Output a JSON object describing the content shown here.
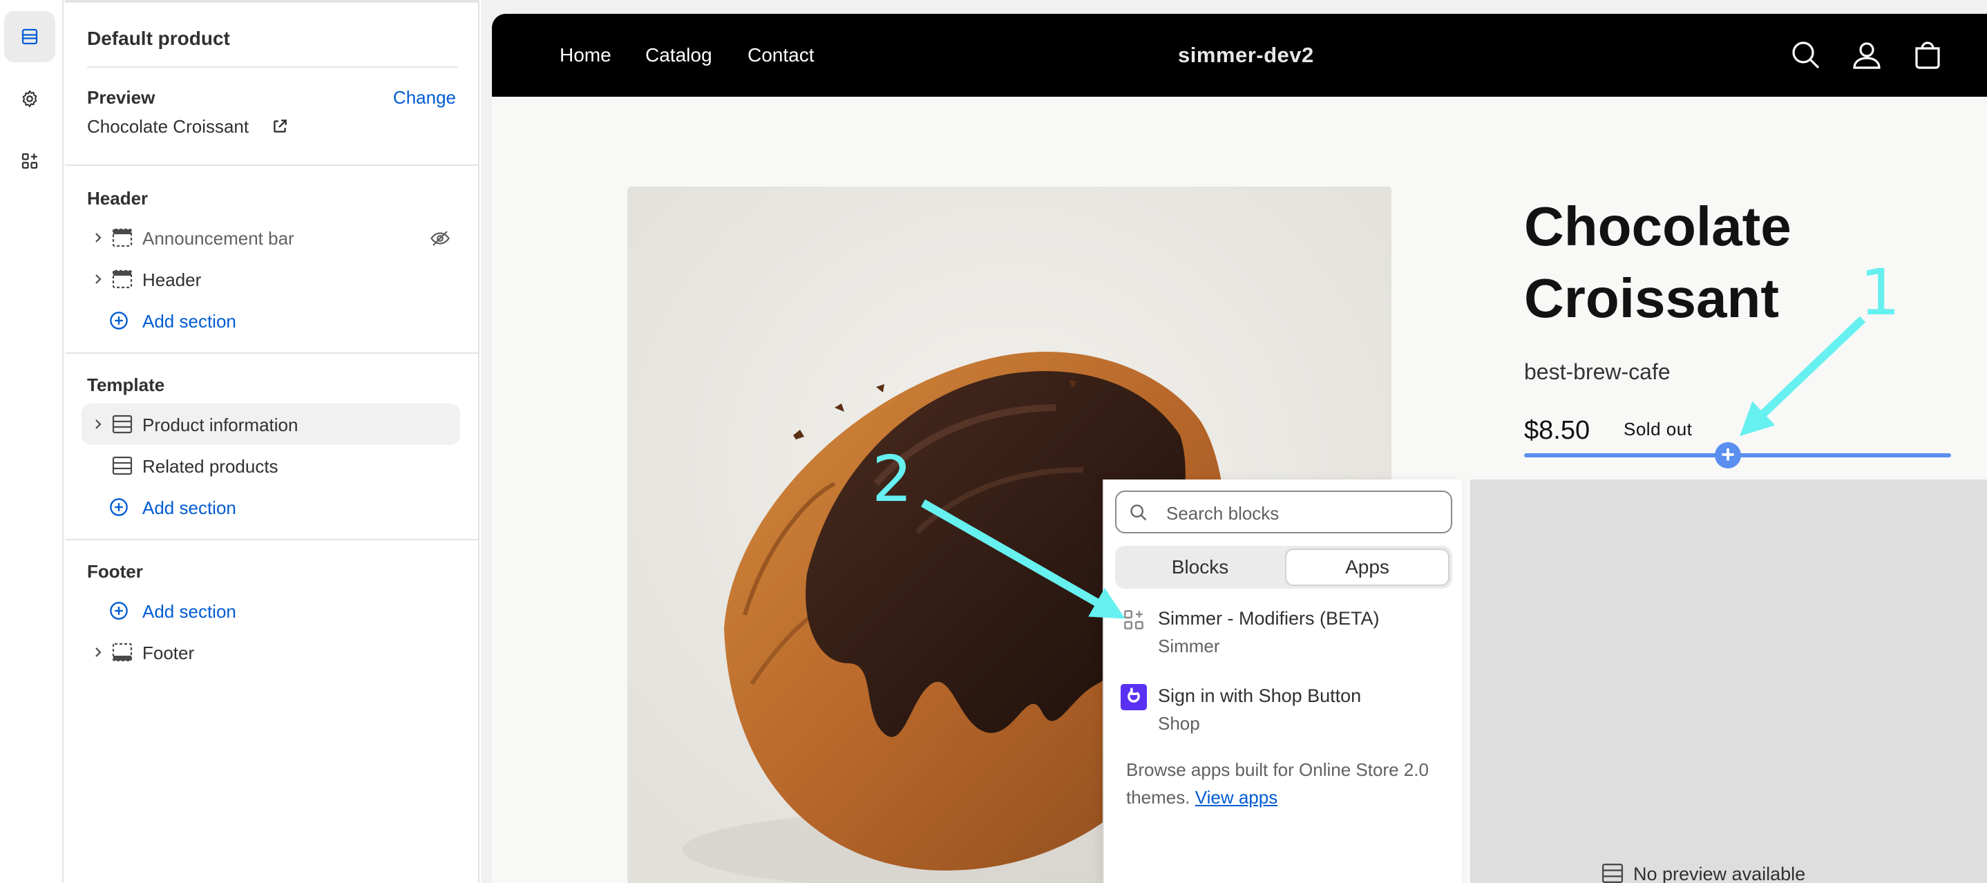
{
  "rail": {
    "items": [
      {
        "name": "sections",
        "icon": "sections-icon",
        "active": true
      },
      {
        "name": "settings",
        "icon": "gear-icon",
        "active": false
      },
      {
        "name": "apps",
        "icon": "apps-icon",
        "active": false
      }
    ]
  },
  "sidebar": {
    "title": "Default product",
    "preview": {
      "label": "Preview",
      "change_label": "Change",
      "product": "Chocolate Croissant",
      "open_icon": "external-link-icon"
    },
    "header_group": {
      "label": "Header",
      "items": [
        {
          "label": "Announcement bar",
          "hidden": true,
          "hidden_icon": "eye-off-icon"
        },
        {
          "label": "Header"
        }
      ],
      "add_label": "Add section"
    },
    "template_group": {
      "label": "Template",
      "items": [
        {
          "label": "Product information",
          "selected": true
        },
        {
          "label": "Related products"
        }
      ],
      "add_label": "Add section"
    },
    "footer_group": {
      "label": "Footer",
      "add_label": "Add section",
      "items": [
        {
          "label": "Footer"
        }
      ]
    }
  },
  "store": {
    "nav": [
      "Home",
      "Catalog",
      "Contact"
    ],
    "brand": "simmer-dev2",
    "header_icons": [
      "search-icon",
      "account-icon",
      "cart-icon"
    ],
    "product": {
      "title_line1": "Chocolate",
      "title_line2": "Croissant",
      "vendor": "best-brew-cafe",
      "price": "$8.50",
      "badge": "Sold out"
    },
    "no_preview": "No preview available"
  },
  "picker": {
    "search_placeholder": "Search blocks",
    "tabs": [
      {
        "label": "Blocks",
        "selected": false
      },
      {
        "label": "Apps",
        "selected": true
      }
    ],
    "apps": [
      {
        "title": "Simmer - Modifiers (BETA)",
        "vendor": "Simmer",
        "icon": "app-block-icon"
      },
      {
        "title": "Sign in with Shop Button",
        "vendor": "Shop",
        "icon": "shop-logo-icon"
      }
    ],
    "browse_text": "Browse apps built for Online Store 2.0 themes.",
    "browse_link": "View apps"
  },
  "annotations": {
    "labels": [
      "1",
      "2"
    ],
    "color": "#66f0f0"
  },
  "colors": {
    "link": "#005bd3",
    "insert_line": "#5a8ff0",
    "store_header": "#000000",
    "annotation": "#66f0f0",
    "shop_logo": "#5a31f4"
  }
}
